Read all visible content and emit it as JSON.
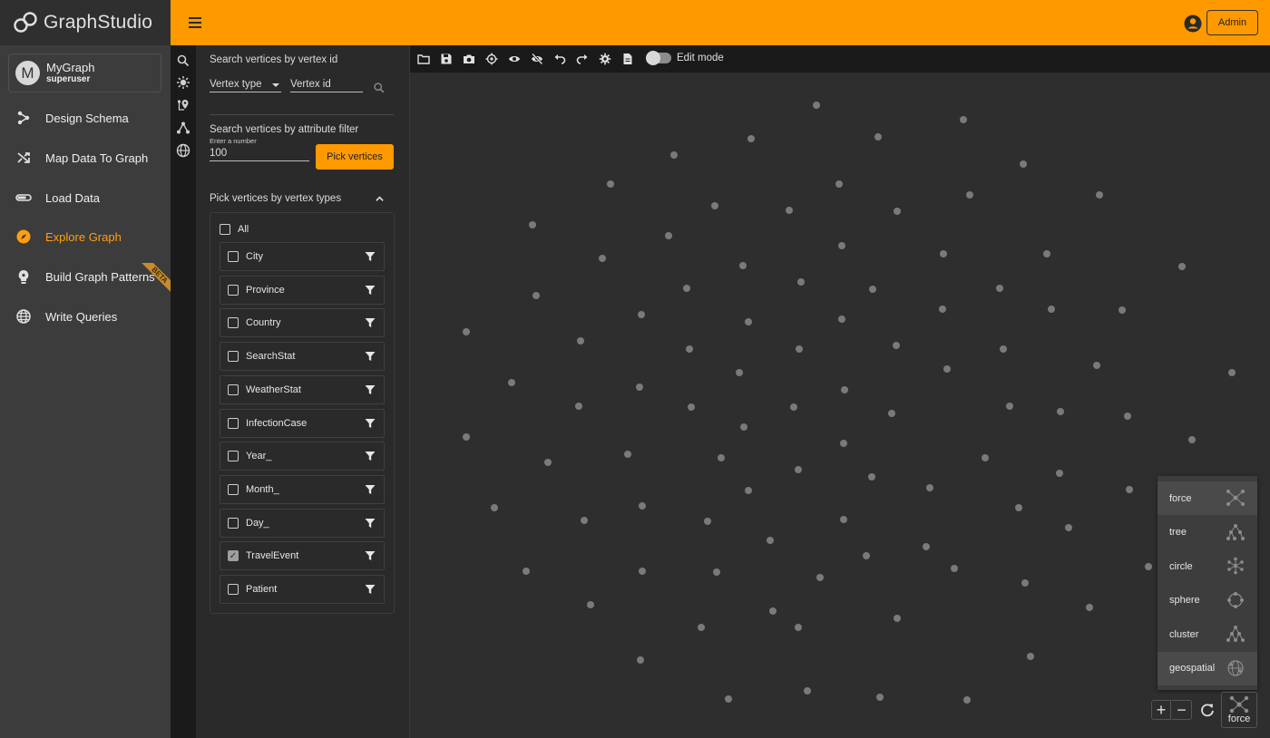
{
  "app": {
    "logo_text": "GraphStudio"
  },
  "graph": {
    "initial": "M",
    "name": "MyGraph",
    "user": "superuser"
  },
  "nav": [
    {
      "label": "Design Schema",
      "icon": "schema-icon"
    },
    {
      "label": "Map Data To Graph",
      "icon": "shuffle-icon"
    },
    {
      "label": "Load Data",
      "icon": "load-icon"
    },
    {
      "label": "Explore Graph",
      "icon": "compass-icon",
      "active": true
    },
    {
      "label": "Build Graph Patterns",
      "icon": "pattern-bulb-icon",
      "badge": "BETA"
    },
    {
      "label": "Write Queries",
      "icon": "globe-icon"
    }
  ],
  "topbar": {
    "admin_label": "Admin"
  },
  "panel": {
    "search_by_id_title": "Search vertices by vertex id",
    "vertex_type_label": "Vertex type",
    "vertex_id_placeholder": "Vertex id",
    "attr_filter_title": "Search vertices by attribute filter",
    "number_label": "Enter a number",
    "number_value": "100",
    "pick_button": "Pick vertices",
    "by_types_title": "Pick vertices by vertex types",
    "all_label": "All",
    "types": [
      {
        "label": "City",
        "checked": false
      },
      {
        "label": "Province",
        "checked": false
      },
      {
        "label": "Country",
        "checked": false
      },
      {
        "label": "SearchStat",
        "checked": false
      },
      {
        "label": "WeatherStat",
        "checked": false
      },
      {
        "label": "InfectionCase",
        "checked": false
      },
      {
        "label": "Year_",
        "checked": false
      },
      {
        "label": "Month_",
        "checked": false
      },
      {
        "label": "Day_",
        "checked": false
      },
      {
        "label": "TravelEvent",
        "checked": true
      },
      {
        "label": "Patient",
        "checked": false
      }
    ]
  },
  "canvas": {
    "edit_mode_label": "Edit mode",
    "layouts": [
      "force",
      "tree",
      "circle",
      "sphere",
      "cluster",
      "geospatial"
    ],
    "current_layout": "force"
  },
  "colors": {
    "accent": "#ff9900",
    "active_nav": "#ff9f10",
    "vertex": "#7a7a7a"
  }
}
